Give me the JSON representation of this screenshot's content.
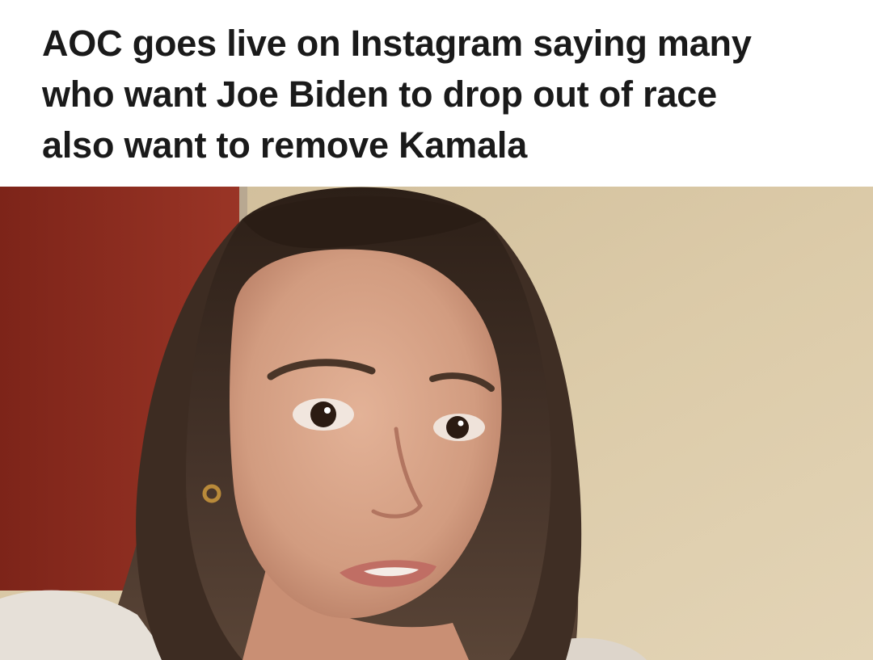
{
  "article": {
    "headline_lines": [
      "AOC goes live on Instagram saying many",
      "who want Joe Biden to drop out of race",
      "also want to remove Kamala"
    ]
  },
  "photo": {
    "subject": "woman-speaking-to-camera",
    "colors": {
      "left_wall": "#8f2e21",
      "right_wall": "#dac9a8",
      "hair": "#3a2a1f",
      "skin": "#d9a589",
      "shirt": "#e6e0d8"
    }
  }
}
